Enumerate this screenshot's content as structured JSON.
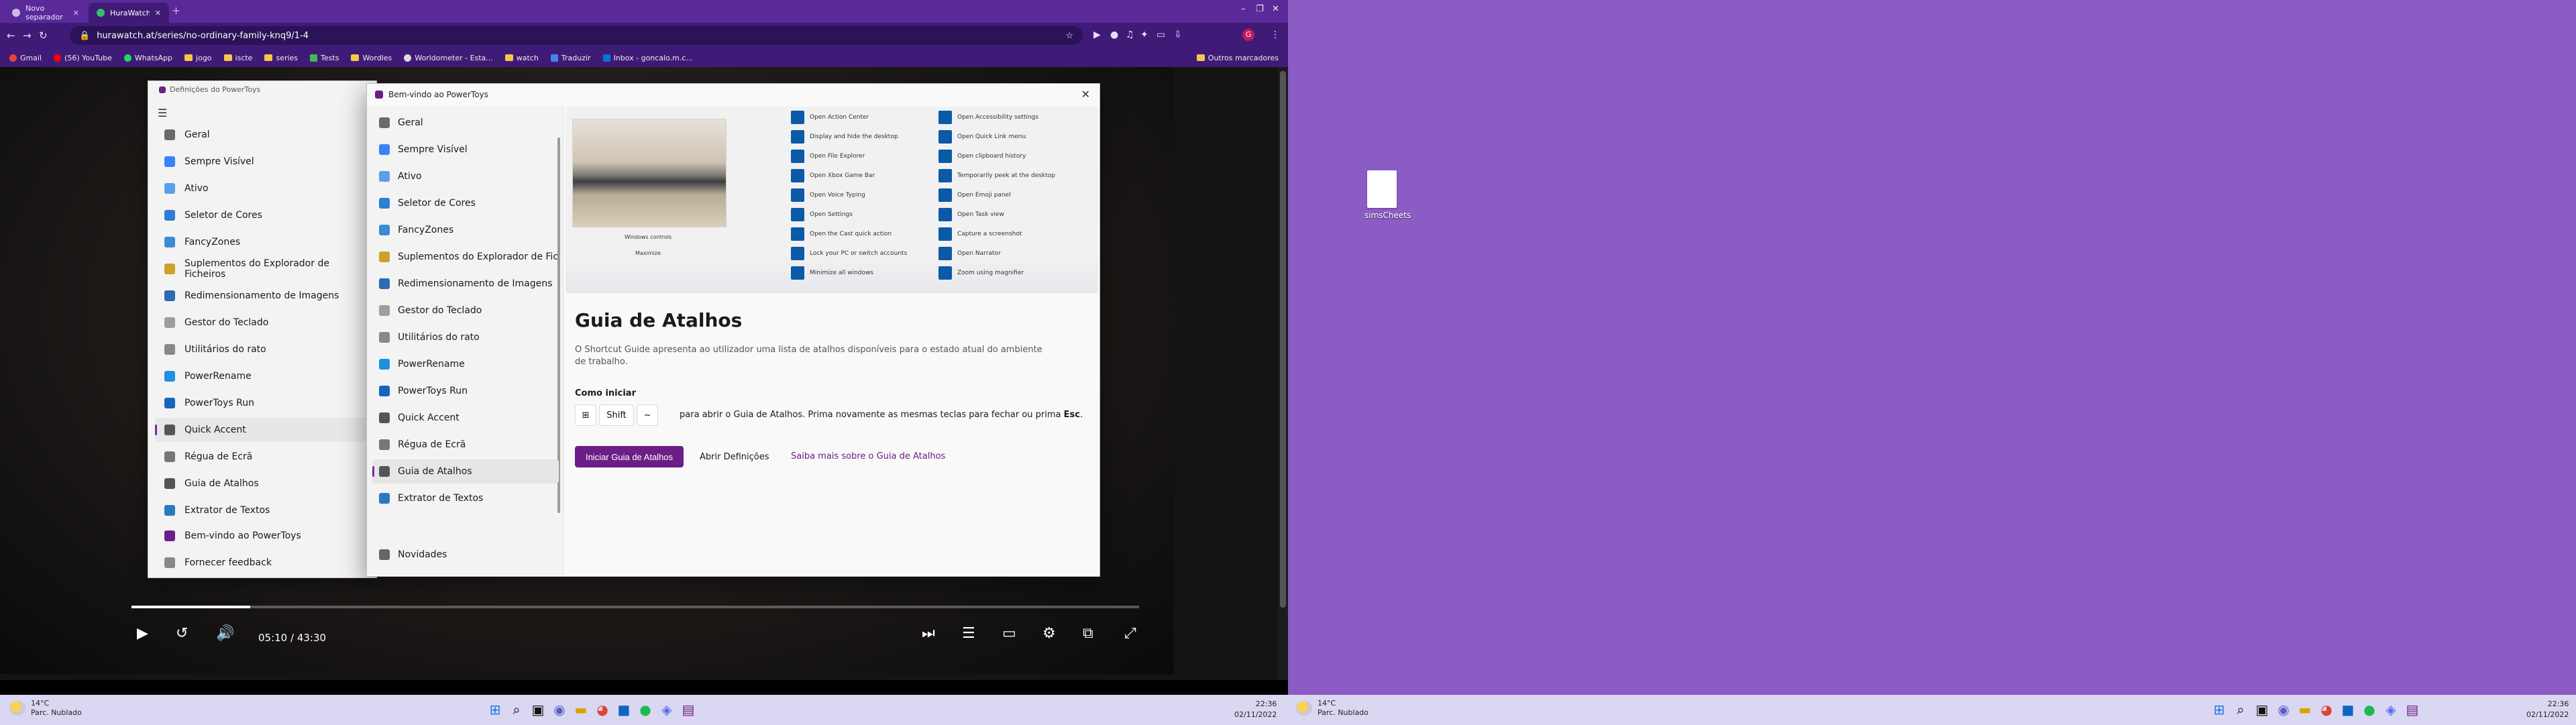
{
  "browser": {
    "tabs": [
      {
        "label": "Novo separador",
        "active": false
      },
      {
        "label": "HuraWatch | Watch No Ordinary",
        "active": true
      }
    ],
    "address": "hurawatch.at/series/no-ordinary-family-knq9/1-4",
    "bookmarks": [
      "Gmail",
      "(56) YouTube",
      "WhatsApp",
      "jogo",
      "iscte",
      "series",
      "Tests",
      "Wordles",
      "Worldometer - Esta...",
      "watch",
      "Traduzir",
      "Inbox - goncalo.m.c..."
    ],
    "other_bookmarks": "Outros marcadores",
    "accent": "#3f1b77"
  },
  "player": {
    "time": "05:10 / 43:30",
    "progress_fraction": 0.118
  },
  "pt_settings": {
    "title": "Definições do PowerToys",
    "items": [
      "Geral",
      "Sempre Visível",
      "Ativo",
      "Seletor de Cores",
      "FancyZones",
      "Suplementos do Explorador de Ficheiros",
      "Redimensionamento de Imagens",
      "Gestor do Teclado",
      "Utilitários do rato",
      "PowerRename",
      "PowerToys Run",
      "Quick Accent",
      "Régua de Ecrã",
      "Guia de Atalhos",
      "Extrator de Textos"
    ],
    "footer": [
      "Bem-vindo ao PowerToys",
      "Fornecer feedback"
    ],
    "active": "Quick Accent"
  },
  "welcome": {
    "title": "Bem-vindo ao PowerToys",
    "nav": [
      "Geral",
      "Sempre Visível",
      "Ativo",
      "Seletor de Cores",
      "FancyZones",
      "Suplementos do Explorador de Fiche",
      "Redimensionamento de Imagens",
      "Gestor do Teclado",
      "Utilitários do rato",
      "PowerRename",
      "PowerToys Run",
      "Quick Accent",
      "Régua de Ecrã",
      "Guia de Atalhos",
      "Extrator de Textos"
    ],
    "nav_footer": "Novidades",
    "active": "Guia de Atalhos",
    "heading": "Guia de Atalhos",
    "description": "O Shortcut Guide apresenta ao utilizador uma lista de atalhos disponíveis para o estado atual do ambiente de trabalho.",
    "how_to_start": "Como iniciar",
    "keys": [
      "⊞",
      "Shift",
      "~"
    ],
    "hint_prefix": "para abrir o Guia de Atalhos. Prima novamente as mesmas teclas para fechar ou prima ",
    "hint_key": "Esc",
    "hint_suffix": ".",
    "btn_launch": "Iniciar Guia de Atalhos",
    "btn_settings": "Abrir Definições",
    "link_learn": "Saiba mais sobre o Guia de Atalhos",
    "hero": {
      "left_label": "Windows controls",
      "left_sublabel": "Maximize",
      "col1": [
        "Open Action Center",
        "Display and hide the desktop",
        "Open File Explorer",
        "Open Xbox Game Bar",
        "Open Voice Typing",
        "Open Settings",
        "Open the Cast quick action",
        "Lock your PC or switch accounts",
        "Minimize all windows"
      ],
      "col2": [
        "Open Accessibility settings",
        "Open Quick Link menu",
        "Open clipboard history",
        "Temporarily peek at the desktop",
        "Open Emoji panel",
        "Open Task view",
        "Capture a screenshot",
        "Open Narrator",
        "Zoom using magnifier"
      ]
    }
  },
  "taskbar": {
    "weather_temp": "14°C",
    "weather_desc": "Parc. Nublado",
    "time": "22:36",
    "date": "02/11/2022"
  },
  "desktop": {
    "icon_label": "simsCheets",
    "background": "#8a5cc4"
  }
}
